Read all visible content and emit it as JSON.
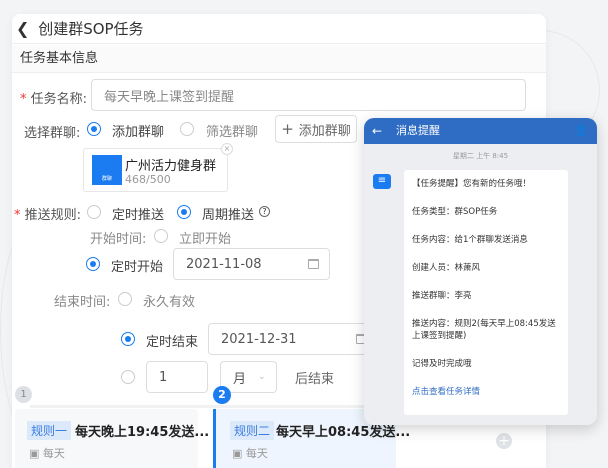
{
  "header": {
    "back_icon": "chevron-left-icon",
    "title": "创建群SOP任务"
  },
  "section": {
    "title": "任务基本信息"
  },
  "form": {
    "task_name": {
      "label": "任务名称:",
      "value": "每天早晚上课签到提醒"
    },
    "group": {
      "label": "选择群聊:",
      "options": [
        "添加群聊",
        "筛选群聊"
      ],
      "selected": "添加群聊",
      "add_button": "添加群聊"
    },
    "group_card": {
      "name": "广州活力健身群",
      "count": "468/500",
      "badge": "群聊"
    },
    "push_rule": {
      "label": "推送规则:",
      "options": [
        "定时推送",
        "周期推送"
      ],
      "selected": "周期推送"
    },
    "start": {
      "label": "开始时间:",
      "options": [
        "立即开始",
        "定时开始"
      ],
      "selected": "定时开始",
      "date": "2021-11-08"
    },
    "end": {
      "label": "结束时间:",
      "options": [
        "永久有效",
        "定时结束"
      ],
      "selected": "定时结束",
      "date": "2021-12-31",
      "count": "1",
      "unit": "月",
      "suffix": "后结束"
    }
  },
  "rules": [
    {
      "step": "1",
      "tag": "规则一",
      "title": "每天晚上19:45发送...",
      "freq": "每天",
      "active": false
    },
    {
      "step": "2",
      "tag": "规则二",
      "title": "每天早上08:45发送...",
      "freq": "每天",
      "active": true
    }
  ],
  "phone": {
    "title": "消息提醒",
    "time": "星期二 上午 8:45",
    "lines": [
      "【任务提醒】您有新的任务哦！",
      "任务类型：群SOP任务",
      "任务内容：给1个群聊发送消息",
      "创建人员：林萧风",
      "推送群聊：李亮",
      "推送内容：规则2(每天早上08:45发送上课签到提醒)",
      "记得及时完成哦"
    ],
    "link": "点击查看任务详情"
  },
  "colors": {
    "accent": "#1a7cf0",
    "phone_bar": "#2f6cc3"
  }
}
